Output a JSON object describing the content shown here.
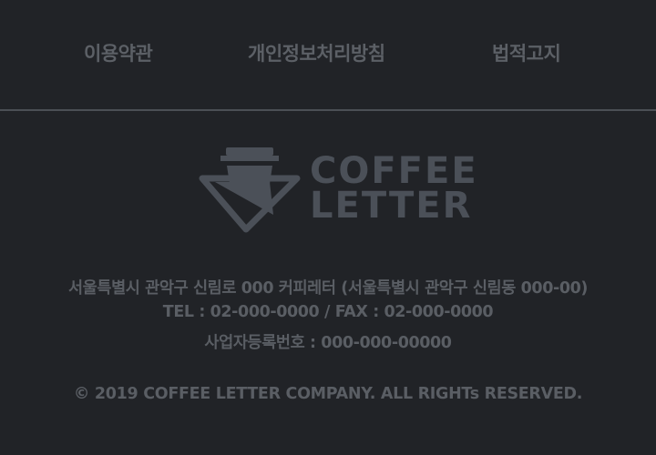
{
  "nav": {
    "terms": "이용약관",
    "privacy": "개인정보처리방침",
    "legal": "법적고지"
  },
  "logo": {
    "line1": "COFFEE",
    "line2": "LETTER"
  },
  "info": {
    "address": "서울특별시 관악구 신림로 000 커피레터 (서울특별시 관악구 신림동 000-00)",
    "phone": "TEL : 02-000-0000 / FAX : 02-000-0000",
    "business_number": "사업자등록번호 : 000-000-00000"
  },
  "copyright": "© 2019 COFFEE LETTER COMPANY. ALL RIGHTs RESERVED.",
  "colors": {
    "background": "#212327",
    "text": "#5c6066",
    "divider": "#4b4f55"
  }
}
